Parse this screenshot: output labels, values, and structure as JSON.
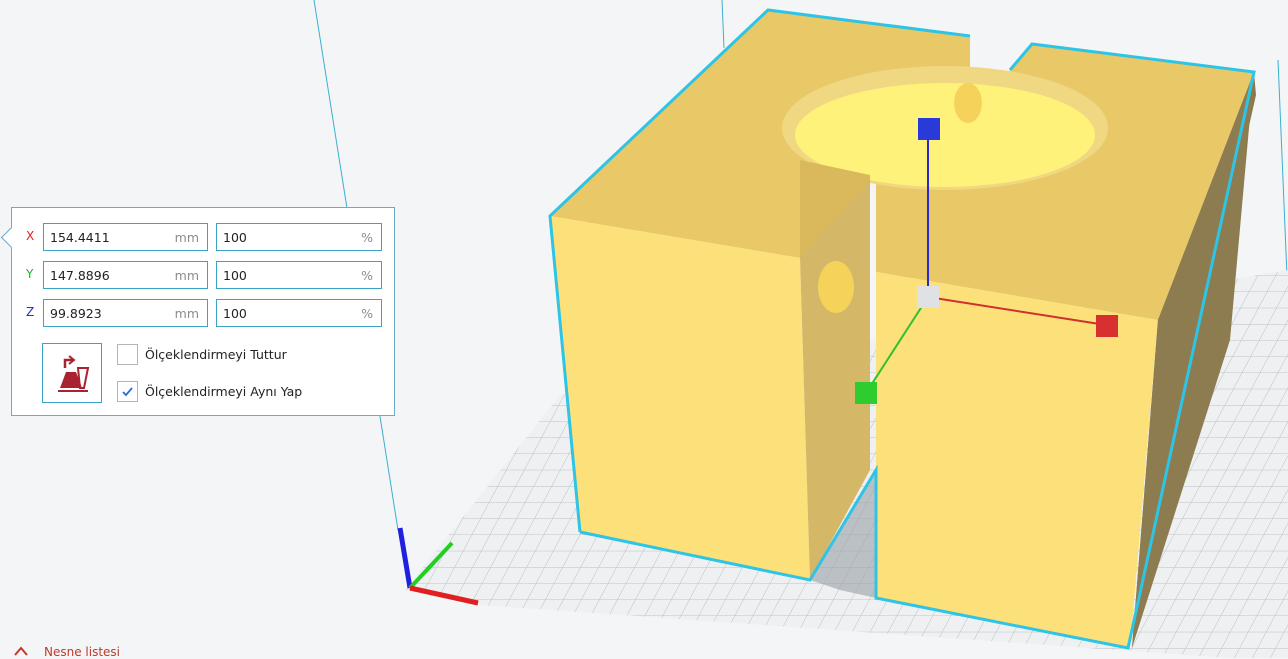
{
  "scale_panel": {
    "rows": [
      {
        "axis": "X",
        "axis_color": "#e02020",
        "mm_value": "154.4411",
        "mm_unit": "mm",
        "percent_value": "100",
        "percent_unit": "%"
      },
      {
        "axis": "Y",
        "axis_color": "#1fb51f",
        "mm_value": "147.8896",
        "mm_unit": "mm",
        "percent_value": "100",
        "percent_unit": "%"
      },
      {
        "axis": "Z",
        "axis_color": "#2030d0",
        "mm_value": "99.8923",
        "mm_unit": "mm",
        "percent_value": "100",
        "percent_unit": "%"
      }
    ],
    "uniform_scale_icon": "uniform-scale-icon",
    "snap_scaling_label": "Ölçeklendirmeyi Tuttur",
    "snap_scaling_checked": false,
    "uniform_scaling_label": "Ölçeklendirmeyi Aynı Yap",
    "uniform_scaling_checked": true
  },
  "object_list": {
    "label": "Nesne listesi",
    "icon": "chevron-up-icon"
  },
  "colors": {
    "model_fill": "#f2d36c",
    "selection_outline": "#2ec4e6",
    "build_plate_grid": "#b8bcc0",
    "accent_red": "#c0392b"
  }
}
